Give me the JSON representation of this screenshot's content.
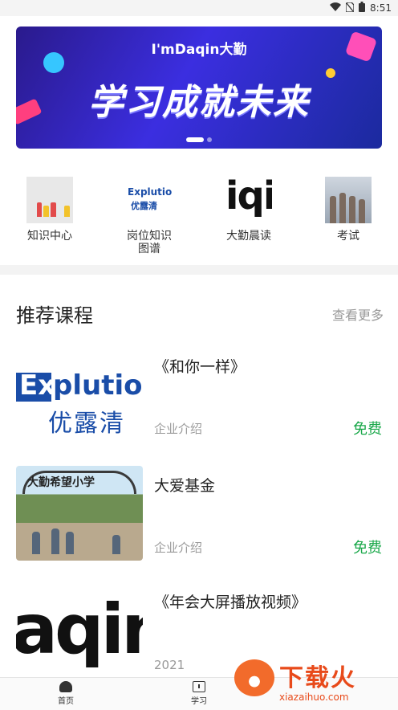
{
  "status_bar": {
    "time": "8:51"
  },
  "banner": {
    "brand": "I'mDaqin大勤",
    "headline": "学习成就未来"
  },
  "quick_nav": [
    {
      "label": "知识中心",
      "icon": "product-bottles-thumbnail"
    },
    {
      "label": "岗位知识\n图谱",
      "icon": "explution-logo-thumbnail",
      "logo_text_top": "Explution",
      "logo_text_bottom": "优露清"
    },
    {
      "label": "大勤晨读",
      "icon": "iqii-logo-thumbnail",
      "logo_text": "iqii"
    },
    {
      "label": "考试",
      "icon": "group-photo-thumbnail"
    }
  ],
  "section": {
    "title": "推荐课程",
    "more": "查看更多"
  },
  "courses": [
    {
      "title": "《和你一样》",
      "category": "企业介绍",
      "price": "免费",
      "cover": "explution-logo"
    },
    {
      "title": "大爱基金",
      "category": "企业介绍",
      "price": "免费",
      "cover": "school-gate-photo"
    },
    {
      "title": "《年会大屏播放视频》",
      "category": "2021",
      "price": "",
      "cover": "aqin-logo"
    }
  ],
  "tabbar": [
    {
      "label": "首页",
      "icon": "home-icon"
    },
    {
      "label": "学习",
      "icon": "study-icon"
    }
  ],
  "watermark": {
    "text": "下载火",
    "url": "xiazaihuo.com"
  },
  "colors": {
    "price_green": "#1aa84a",
    "banner_blue": "#3b2ee0"
  }
}
